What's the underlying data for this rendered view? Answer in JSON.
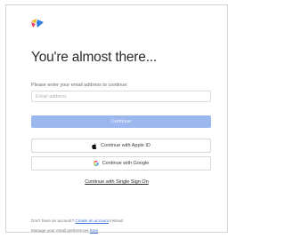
{
  "colors": {
    "accent_button": "#9cb7ee",
    "link": "#3c6fd8",
    "logo_blue": "#2f7de1",
    "logo_yellow": "#f2b31d",
    "logo_red": "#e2445c"
  },
  "logo": {
    "icon": "multicolor-app-logo"
  },
  "heading": "You're almost there...",
  "helper_text": "Please enter your email address to continue:",
  "email": {
    "value": "",
    "placeholder": "Email address"
  },
  "continue_button": "Continue",
  "apple_button": {
    "label": "Continue with Apple ID",
    "icon": "apple-icon"
  },
  "google_button": {
    "label": "Continue with Google",
    "icon": "google-icon"
  },
  "sso_link": "Continue with Single Sign On",
  "footer": {
    "signup_prefix": "Don't have an account?",
    "signup_link": "Create an account",
    "signup_suffix": "instead",
    "manage_prefix": "Manage your email preferences",
    "manage_link": "here"
  }
}
